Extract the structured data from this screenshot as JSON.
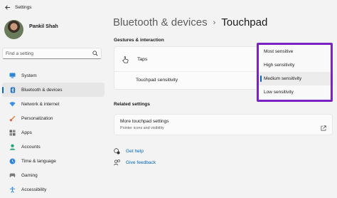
{
  "window": {
    "title": "Settings"
  },
  "profile": {
    "name": "Pankil Shah"
  },
  "search": {
    "placeholder": "Find a setting"
  },
  "sidebar": {
    "items": [
      {
        "label": "System",
        "icon": "monitor-icon",
        "active": false
      },
      {
        "label": "Bluetooth & devices",
        "icon": "bluetooth-icon",
        "active": true
      },
      {
        "label": "Network & internet",
        "icon": "wifi-icon",
        "active": false
      },
      {
        "label": "Personalization",
        "icon": "brush-icon",
        "active": false
      },
      {
        "label": "Apps",
        "icon": "apps-icon",
        "active": false
      },
      {
        "label": "Accounts",
        "icon": "person-icon",
        "active": false
      },
      {
        "label": "Time & language",
        "icon": "globe-clock-icon",
        "active": false
      },
      {
        "label": "Gaming",
        "icon": "gamepad-icon",
        "active": false
      },
      {
        "label": "Accessibility",
        "icon": "accessibility-icon",
        "active": false
      }
    ]
  },
  "breadcrumb": {
    "parent": "Bluetooth & devices",
    "separator": "›",
    "current": "Touchpad"
  },
  "gestures": {
    "section_label": "Gestures & interaction",
    "taps_label": "Taps",
    "sensitivity_label": "Touchpad sensitivity"
  },
  "dropdown": {
    "options": [
      "Most sensitive",
      "High sensitivity",
      "Medium sensitivity",
      "Low sensitivity"
    ],
    "selected": "Medium sensitivity"
  },
  "related": {
    "section_label": "Related settings",
    "more_title": "More touchpad settings",
    "more_subtitle": "Pointer icons and visibility"
  },
  "help": {
    "get_help": "Get help",
    "give_feedback": "Give feedback"
  },
  "colors": {
    "accent": "#0067c0",
    "highlight_border": "#7a23c4",
    "link": "#0066b8"
  }
}
